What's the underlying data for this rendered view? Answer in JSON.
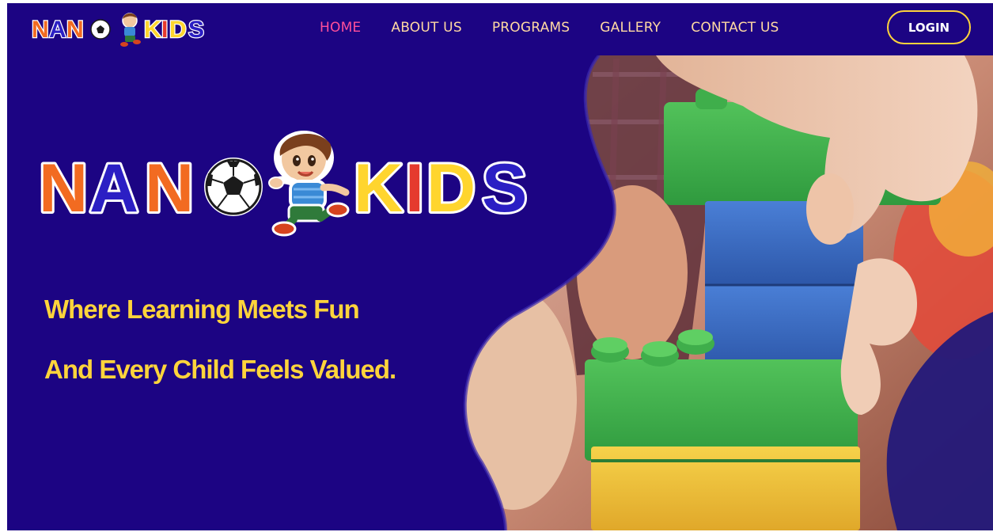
{
  "brand": {
    "name": "NANO KIDS",
    "word_left": "NANO",
    "word_right": "KIDS"
  },
  "nav": {
    "items": [
      {
        "label": "HOME",
        "active": true
      },
      {
        "label": "ABOUT US",
        "active": false
      },
      {
        "label": "PROGRAMS",
        "active": false
      },
      {
        "label": "GALLERY",
        "active": false
      },
      {
        "label": "CONTACT US",
        "active": false
      }
    ],
    "login_label": "LOGIN"
  },
  "hero": {
    "tagline_line1": "Where Learning Meets Fun",
    "tagline_line2": "And Every Child Feels Valued.",
    "photo_subject": "child-stacking-building-blocks"
  },
  "colors": {
    "background": "#1c0483",
    "accent_yellow": "#ffd43b",
    "active_nav": "#ff4f9a",
    "nav_text": "#ffd9a3",
    "logo_orange": "#f26b21",
    "logo_blue": "#2b1fc4",
    "logo_yellow": "#ffd52e",
    "logo_red": "#e53a2e"
  }
}
